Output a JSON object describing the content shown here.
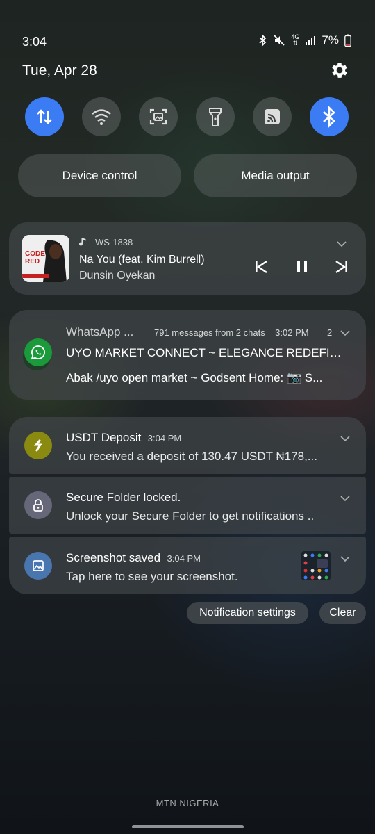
{
  "status": {
    "time": "3:04",
    "network": "4G",
    "battery": "7%",
    "icons": [
      "bluetooth-icon",
      "mute-icon",
      "4g-data-icon",
      "signal-icon",
      "battery-icon"
    ]
  },
  "date": "Tue, Apr 28",
  "quick_toggles": [
    {
      "name": "mobile-data",
      "on": true
    },
    {
      "name": "wifi",
      "on": false
    },
    {
      "name": "screen-capture",
      "on": false
    },
    {
      "name": "flashlight",
      "on": false
    },
    {
      "name": "cast",
      "on": false
    },
    {
      "name": "bluetooth",
      "on": true
    }
  ],
  "buttons": {
    "device_control": "Device control",
    "media_output": "Media output",
    "notification_settings": "Notification settings",
    "clear": "Clear"
  },
  "media": {
    "device": "WS-1838",
    "title": "Na You (feat. Kim Burrell)",
    "artist": "Dunsin Oyekan",
    "album_art_text": "CODE RED"
  },
  "whatsapp": {
    "app": "WhatsApp ...",
    "meta": "791 messages from 2 chats",
    "time": "3:02 PM",
    "count": "2",
    "line1": "UYO MARKET CONNECT  ~ ELEGANCE REDEFINED",
    "line2": "Abak /uyo open market  ~ Godsent Home: 📷 S..."
  },
  "notifications": [
    {
      "title": "USDT Deposit",
      "time": "3:04 PM",
      "body": "You received a deposit of 130.47 USDT ₦178,..."
    },
    {
      "title": "Secure Folder locked.",
      "time": "",
      "body": "Unlock your Secure Folder to get notifications .."
    },
    {
      "title": "Screenshot saved",
      "time": "3:04 PM",
      "body": "Tap here to see your screenshot."
    }
  ],
  "carrier": "MTN NIGERIA",
  "colors": {
    "accent": "#3b7cf5",
    "whatsapp": "#1a9a3a",
    "usdt": "#8a8a10",
    "secure": "#66687a",
    "screenshot": "#4a76b0"
  }
}
